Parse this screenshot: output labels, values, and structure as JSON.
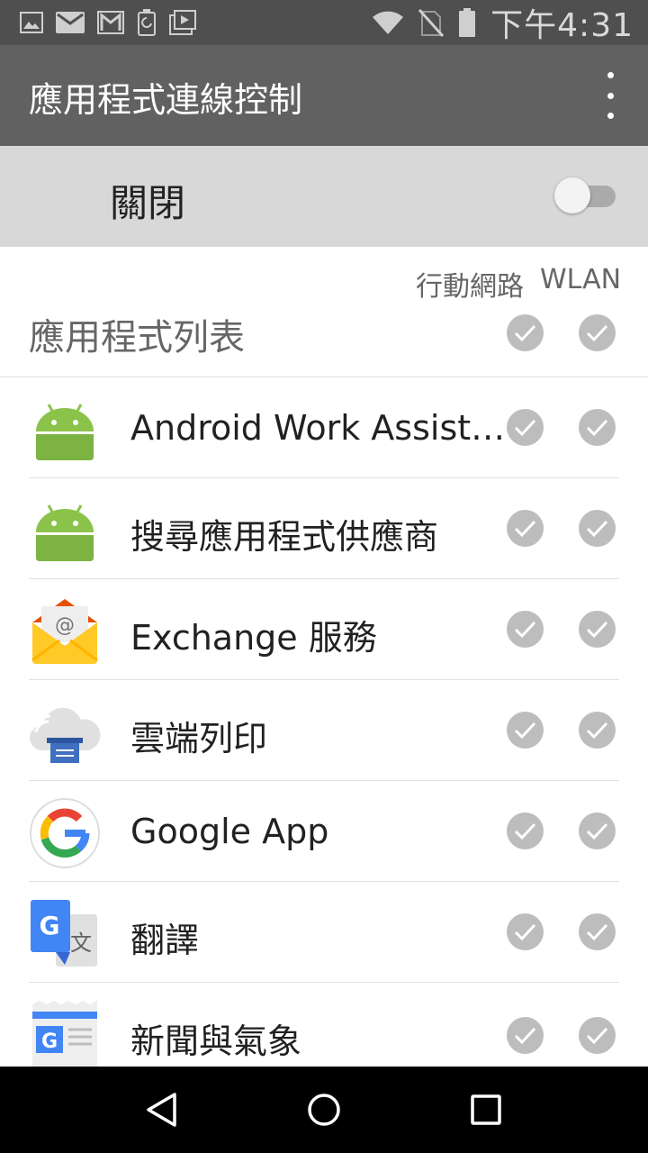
{
  "status_bar": {
    "time": "下午4:31",
    "left_icons": [
      "image-icon",
      "mail-icon",
      "gmail-icon",
      "battery-saver-icon",
      "media-icon"
    ],
    "right_icons": [
      "wifi-icon",
      "no-sim-icon",
      "battery-icon"
    ]
  },
  "app_bar": {
    "title": "應用程式連線控制",
    "menu_icon": "overflow-menu-icon"
  },
  "master_switch": {
    "label": "關閉",
    "enabled": false
  },
  "columns": {
    "mobile": "行動網路",
    "wlan": "WLAN"
  },
  "list_header": {
    "title": "應用程式列表",
    "mobile_checked": true,
    "wlan_checked": true
  },
  "apps": [
    {
      "name": "Android Work Assist…",
      "icon": "android-icon",
      "mobile_checked": true,
      "wlan_checked": true
    },
    {
      "name": "搜尋應用程式供應商",
      "icon": "android-icon",
      "mobile_checked": true,
      "wlan_checked": true
    },
    {
      "name": "Exchange 服務",
      "icon": "exchange-mail-icon",
      "mobile_checked": true,
      "wlan_checked": true
    },
    {
      "name": "雲端列印",
      "icon": "cloud-print-icon",
      "mobile_checked": true,
      "wlan_checked": true
    },
    {
      "name": "Google App",
      "icon": "google-icon",
      "mobile_checked": true,
      "wlan_checked": true
    },
    {
      "name": "翻譯",
      "icon": "translate-icon",
      "mobile_checked": true,
      "wlan_checked": true
    },
    {
      "name": "新聞與氣象",
      "icon": "news-weather-icon",
      "mobile_checked": true,
      "wlan_checked": true
    }
  ],
  "nav_bar": {
    "buttons": [
      "back-icon",
      "home-icon",
      "recents-icon"
    ]
  },
  "colors": {
    "status_bar": "#4f4f4f",
    "app_bar": "#616161",
    "switch_bar": "#d8d8d8",
    "check_disabled": "#bdbdbd"
  }
}
